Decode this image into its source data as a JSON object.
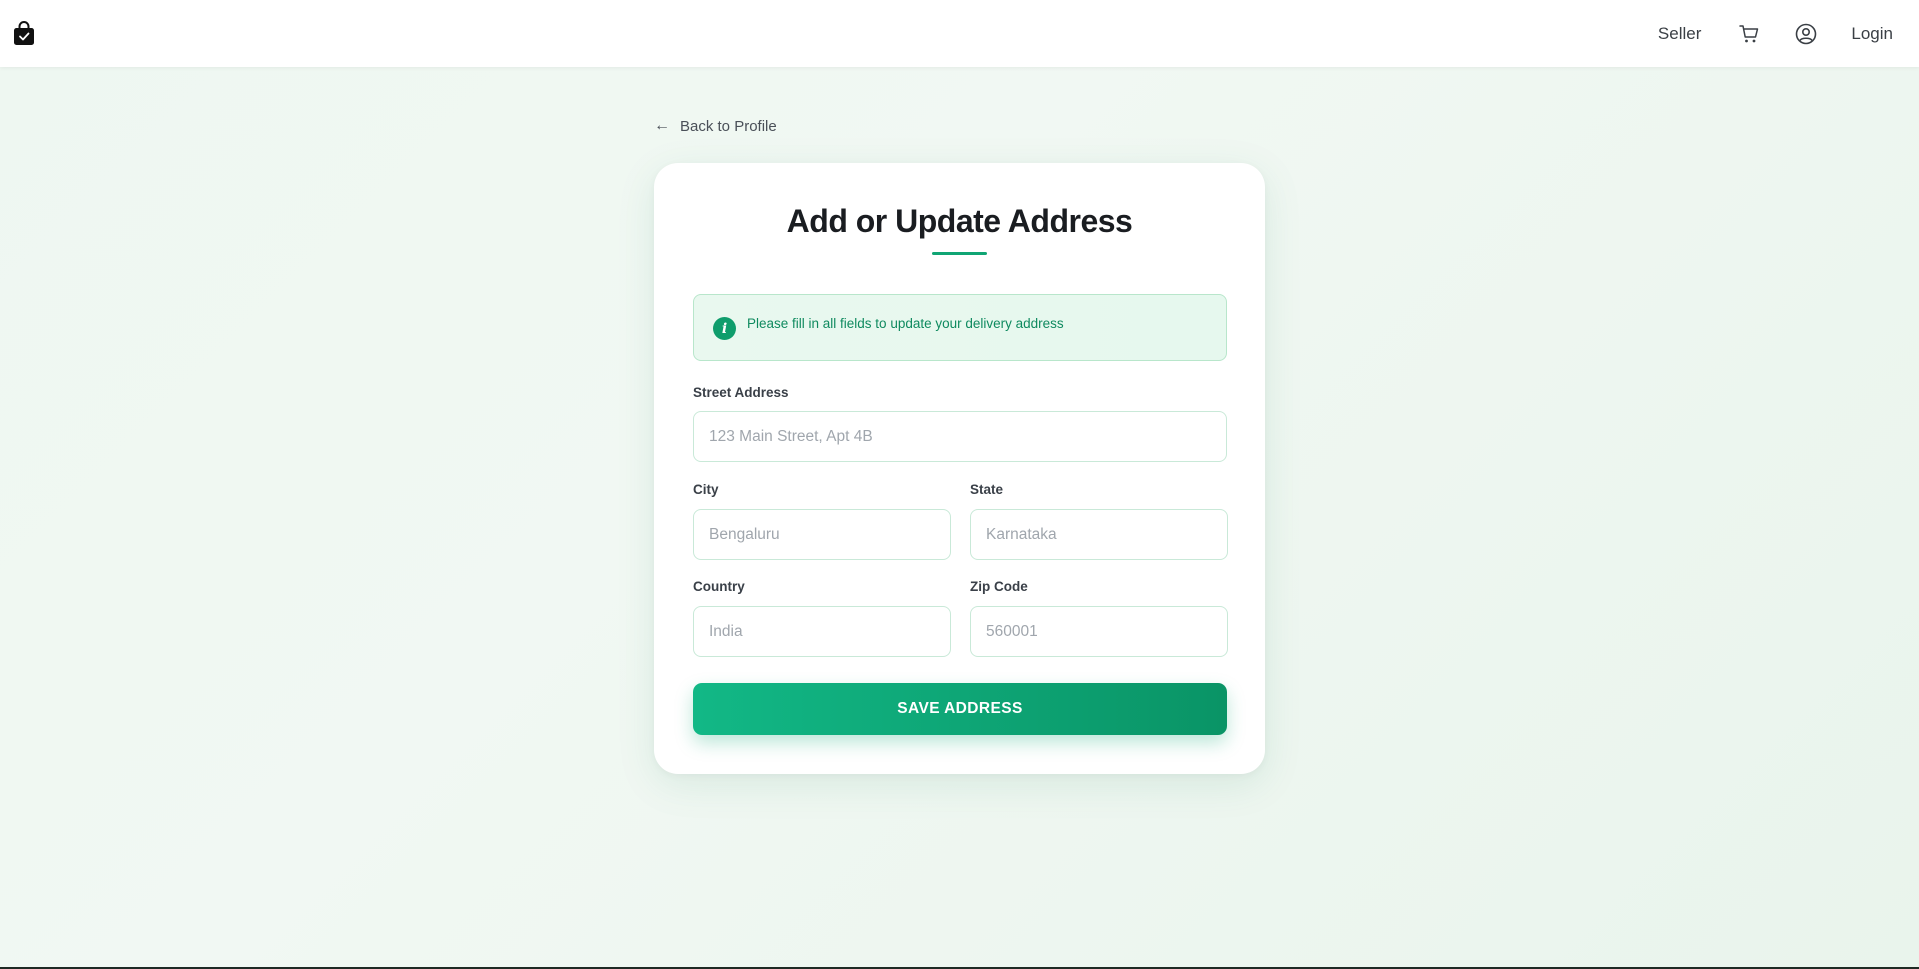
{
  "navbar": {
    "logo_icon": "shopping-bag-icon",
    "seller_label": "Seller",
    "cart_icon": "shopping-cart-icon",
    "user_icon": "user-circle-icon",
    "login_label": "Login"
  },
  "back_link": {
    "arrow": "←",
    "label": "Back to Profile"
  },
  "form": {
    "title": "Add or Update Address",
    "info_icon_glyph": "i",
    "info_message": "Please fill in all fields to update your delivery address",
    "street": {
      "label": "Street Address",
      "placeholder": "123 Main Street, Apt 4B",
      "value": ""
    },
    "city": {
      "label": "City",
      "placeholder": "Bengaluru",
      "value": ""
    },
    "state": {
      "label": "State",
      "placeholder": "Karnataka",
      "value": ""
    },
    "country": {
      "label": "Country",
      "placeholder": "India",
      "value": ""
    },
    "zip": {
      "label": "Zip Code",
      "placeholder": "560001",
      "value": ""
    },
    "save_label": "SAVE ADDRESS"
  },
  "colors": {
    "accent": "#10a574",
    "button_start": "#12b886",
    "button_end": "#0a9466",
    "info_text": "#0f8a5f"
  }
}
